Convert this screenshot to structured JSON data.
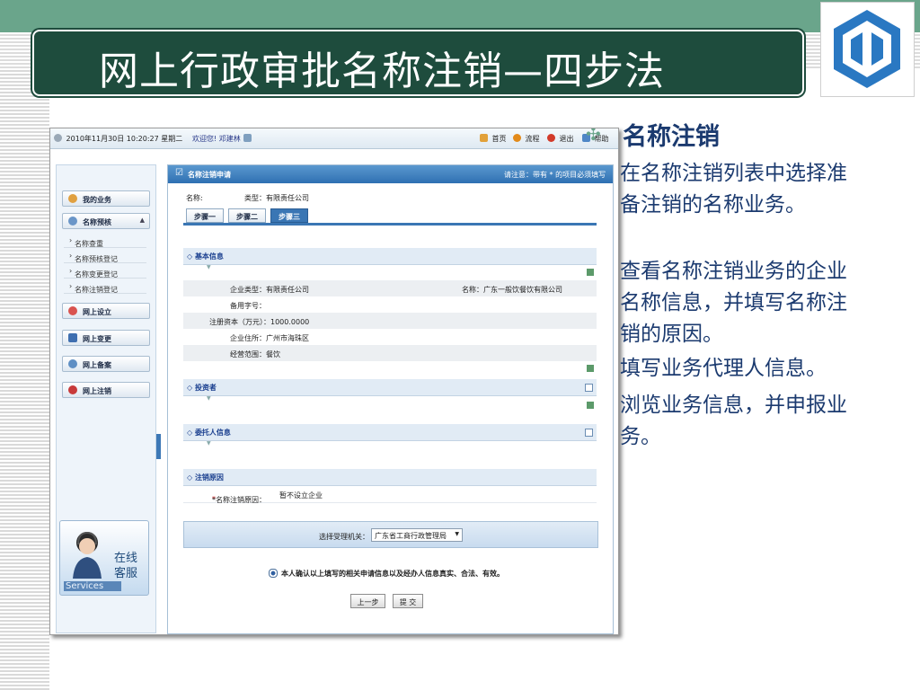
{
  "slide": {
    "title": "网上行政审批名称注销—四步法",
    "right_heading": "名称注销",
    "paragraphs": [
      "在名称注销列表中选择准备注销的名称业务。",
      "查看名称注销业务的企业名称信息，并填写名称注销的原因。",
      "填写业务代理人信息。",
      "浏览业务信息，并申报业务。"
    ],
    "colors": {
      "title_bg": "#1e4c3d",
      "top_band": "#6aa58b",
      "text": "#1b3a6f"
    }
  },
  "app": {
    "datetime": "2010年11月30日 10:20:27 星期二",
    "welcome": "欢迎您! 邓建林",
    "top_links": [
      "首页",
      "流程",
      "退出",
      "帮助"
    ],
    "nav": {
      "my_business": "我的业务",
      "name_preapproval": "名称预核",
      "sub_items": [
        "名称查重",
        "名称预核登记",
        "名称变更登记",
        "名称注销登记"
      ],
      "online_setup": "网上设立",
      "online_change": "网上变更",
      "online_record": "网上备案",
      "online_cancel": "网上注销",
      "service_line1": "在线",
      "service_line2": "客服",
      "service_label": "Services"
    },
    "panel": {
      "title": "名称注销申请",
      "note": "请注意：带有 * 的项目必须填写",
      "name_label": "名称:",
      "type_text": "类型：有限责任公司",
      "steps": [
        "步骤一",
        "步骤二",
        "步骤三"
      ],
      "active_step": 3
    },
    "basic_info": {
      "heading": "◇ 基本信息",
      "company_type": "企业类型：有限责任公司",
      "company_name": "名称：广东一般饮餐饮有限公司",
      "backup_no": "备用字号：",
      "capital": "注册资本（万元）：1000.0000",
      "address": "企业住所：广州市海珠区",
      "scope": "经营范围：餐饮"
    },
    "investors": {
      "heading": "◇ 投资者"
    },
    "agent": {
      "heading": "◇ 委托人信息"
    },
    "cancel_reason": {
      "heading": "◇ 注销原因",
      "label": "*名称注销原因：",
      "value": "暂不设立企业"
    },
    "authority": {
      "label": "选择受理机关：",
      "selected": "广东省工商行政管理局"
    },
    "confirm_text": "本人确认以上填写的相关申请信息以及经办人信息真实、合法、有效。",
    "prev_button": "上一步",
    "submit_button": "提 交"
  }
}
